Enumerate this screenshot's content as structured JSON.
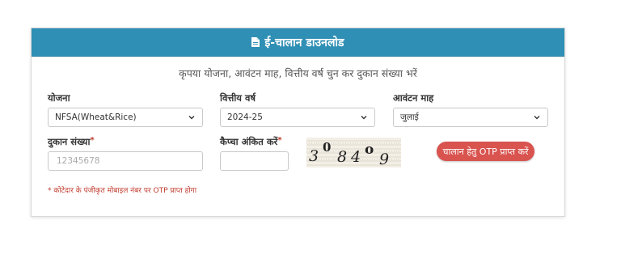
{
  "header": {
    "title": "ई-चालान डाउनलोड",
    "icon": "document-icon"
  },
  "subtitle": "कृपया योजना, आवंटन माह, वित्तीय वर्ष चुन कर दुकान संख्या भरें",
  "fields": {
    "scheme": {
      "label": "योजना",
      "value": "NFSA(Wheat&Rice)"
    },
    "fiscal_year": {
      "label": "वित्तीय वर्ष",
      "value": "2024-25"
    },
    "allocation_month": {
      "label": "आवंटन माह",
      "value": "जुलाई"
    },
    "shop_number": {
      "label": "दुकान संख्या",
      "required_mark": "*",
      "placeholder": "12345678"
    },
    "captcha_input": {
      "label": "कैप्चा अंकित करें",
      "required_mark": "*"
    }
  },
  "captcha": {
    "chars": [
      "3",
      "0",
      "8",
      "4",
      "o",
      "9"
    ]
  },
  "otp_button": {
    "label": "चालान हेतु OTP प्राप्त करें",
    "color": "#d9534f"
  },
  "note": "* कोटेदार के पंजीकृत मोबाइल नंबर पर OTP प्राप्त होगा",
  "colors": {
    "header_bg": "#2f8fb4",
    "note": "#c0392b"
  }
}
